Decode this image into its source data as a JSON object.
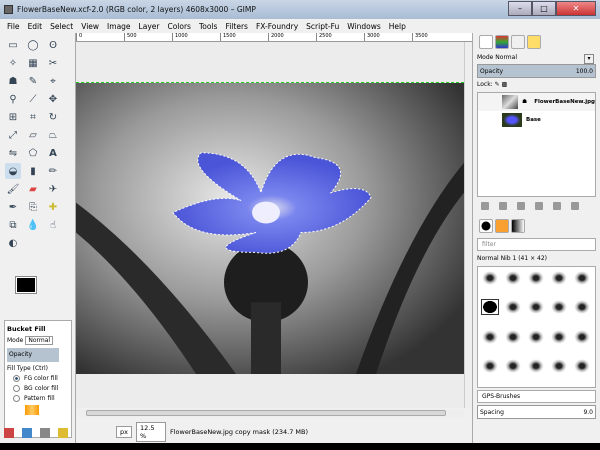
{
  "window": {
    "title": "FlowerBaseNew.xcf-2.0 (RGB color, 2 layers) 4608x3000 – GIMP"
  },
  "menu": [
    "File",
    "Edit",
    "Select",
    "View",
    "Image",
    "Layer",
    "Colors",
    "Tools",
    "Filters",
    "FX-Foundry",
    "Script-Fu",
    "Windows",
    "Help"
  ],
  "ruler": [
    "0",
    "500",
    "1000",
    "1500",
    "2000",
    "2500",
    "3000",
    "3500"
  ],
  "tool_options": {
    "title": "Bucket Fill",
    "mode_label": "Mode",
    "mode_value": "Normal",
    "opacity_label": "Opacity",
    "fill_type_label": "Fill Type  (Ctrl)",
    "fill_options": [
      "FG color fill",
      "BG color fill",
      "Pattern fill"
    ]
  },
  "status": {
    "unit": "px",
    "zoom": "12.5 %",
    "message": "FlowerBaseNew.jpg copy mask (234.7 MB)"
  },
  "layers_panel": {
    "mode_label": "Mode",
    "mode_value": "Normal",
    "opacity_label": "Opacity",
    "opacity_value": "100.0",
    "lock_label": "Lock:",
    "layers": [
      {
        "name": "FlowerBaseNew.jpg"
      },
      {
        "name": "Base"
      }
    ]
  },
  "brushes_panel": {
    "filter_placeholder": "filter",
    "brush_name": "Normal Nib 1 (41 × 42)",
    "tag": "GPS-Brushes",
    "spacing_label": "Spacing",
    "spacing_value": "9.0"
  }
}
